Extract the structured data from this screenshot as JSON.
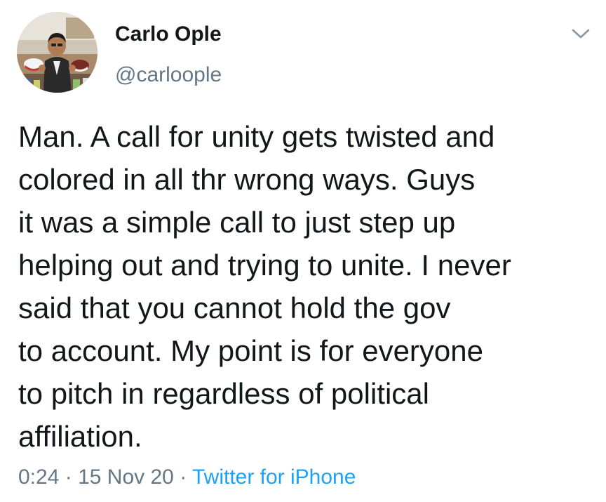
{
  "author": {
    "display_name": "Carlo Ople",
    "handle": "@carloople",
    "avatar_icon": "profile-photo"
  },
  "tweet": {
    "lines": [
      "Man. A call for unity gets twisted and",
      "colored in all thr wrong ways. Guys",
      "it was a simple call to just step up",
      "helping out and trying to unite. I never",
      "said that you cannot hold the gov",
      "to account. My point is for everyone",
      "to pitch in regardless of political",
      "affiliation."
    ]
  },
  "meta": {
    "time": "0:24",
    "separator": "·",
    "date": "15 Nov 20",
    "source": "Twitter for iPhone"
  },
  "menu": {
    "icon": "chevron-down-icon"
  },
  "colors": {
    "text": "#14171a",
    "secondary": "#657786",
    "link": "#1da1f2"
  }
}
